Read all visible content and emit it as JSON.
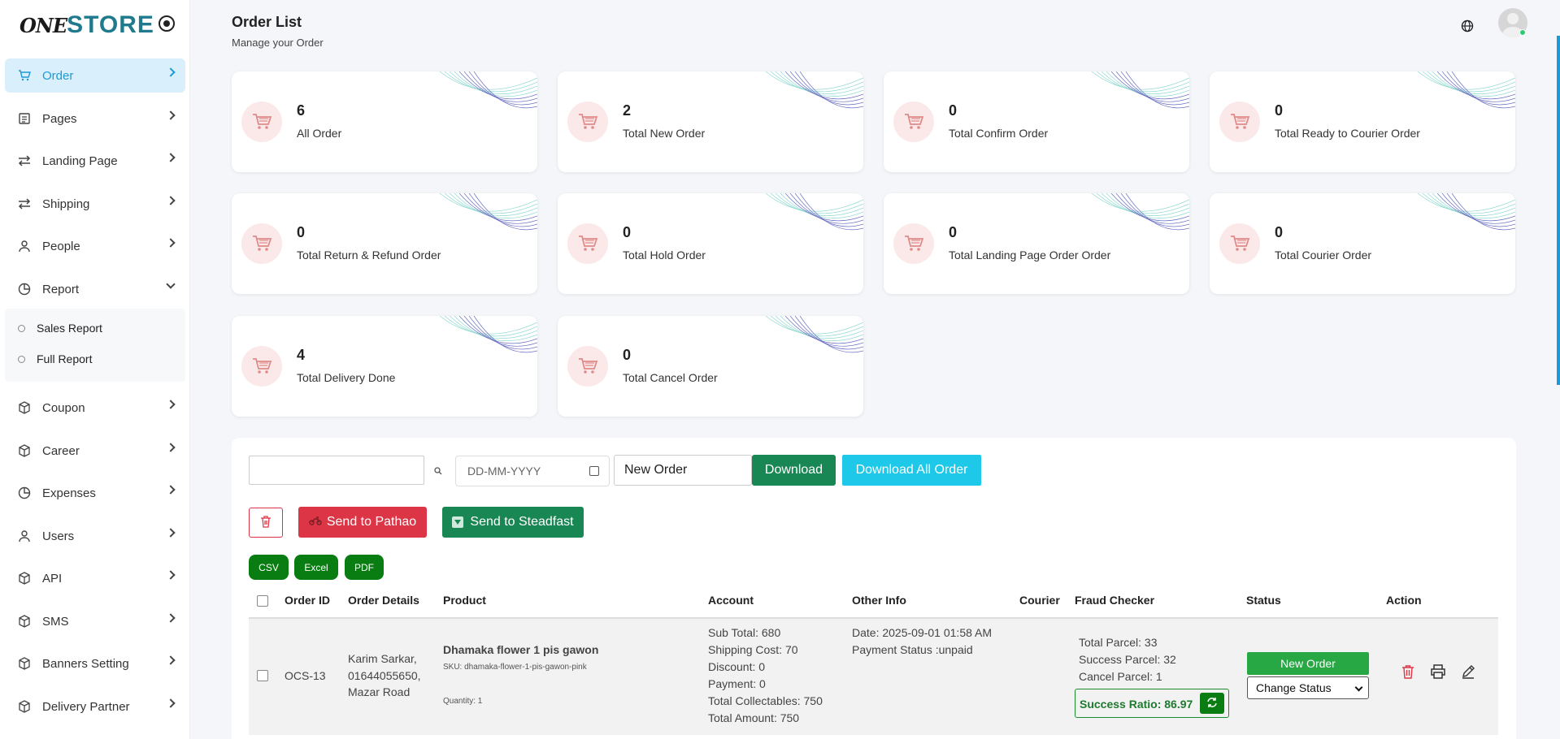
{
  "brand": {
    "logo_one": "ONE",
    "logo_store": "STORE"
  },
  "sidebar": {
    "items": [
      {
        "label": "Order",
        "icon": "cart-icon"
      },
      {
        "label": "Pages",
        "icon": "pages-icon"
      },
      {
        "label": "Landing Page",
        "icon": "swap-icon"
      },
      {
        "label": "Shipping",
        "icon": "swap-icon"
      },
      {
        "label": "People",
        "icon": "person-icon"
      },
      {
        "label": "Report",
        "icon": "pie-chart-icon"
      },
      {
        "label": "Coupon",
        "icon": "box-icon"
      },
      {
        "label": "Career",
        "icon": "box-icon"
      },
      {
        "label": "Expenses",
        "icon": "pie-chart-icon"
      },
      {
        "label": "Users",
        "icon": "person-icon"
      },
      {
        "label": "API",
        "icon": "box-icon"
      },
      {
        "label": "SMS",
        "icon": "box-icon"
      },
      {
        "label": "Banners Setting",
        "icon": "box-icon"
      },
      {
        "label": "Delivery Partner",
        "icon": "box-icon"
      }
    ],
    "report_sub": [
      "Sales Report",
      "Full Report"
    ]
  },
  "header": {
    "title": "Order List",
    "subtitle": "Manage your Order"
  },
  "stats": [
    {
      "value": "6",
      "label": "All Order"
    },
    {
      "value": "2",
      "label": "Total New Order"
    },
    {
      "value": "0",
      "label": "Total Confirm Order"
    },
    {
      "value": "0",
      "label": "Total Ready to Courier Order"
    },
    {
      "value": "0",
      "label": "Total Return & Refund Order"
    },
    {
      "value": "0",
      "label": "Total Hold Order"
    },
    {
      "value": "0",
      "label": "Total Landing Page Order Order"
    },
    {
      "value": "0",
      "label": "Total Courier Order"
    },
    {
      "value": "4",
      "label": "Total Delivery Done"
    },
    {
      "value": "0",
      "label": "Total Cancel Order"
    }
  ],
  "filters": {
    "search_value": "",
    "date_placeholder": "DD-MM-YYYY",
    "status_value": "New Order",
    "download_label": "Download",
    "download_all_label": "Download All Order"
  },
  "actions": {
    "pathao_label": "Send to Pathao",
    "steadfast_label": "Send to Steadfast"
  },
  "exports": [
    "CSV",
    "Excel",
    "PDF"
  ],
  "table": {
    "headers": [
      "Order ID",
      "Order Details",
      "Product",
      "Account",
      "Other Info",
      "Courier",
      "Fraud Checker",
      "Status",
      "Action"
    ],
    "row": {
      "order_id": "OCS-13",
      "details": [
        "Karim Sarkar,",
        "01644055650,",
        "Mazar Road"
      ],
      "product_name": "Dhamaka flower 1 pis gawon",
      "product_sku": "SKU: dhamaka-flower-1-pis-gawon-pink",
      "product_qty": "Quantity: 1",
      "account": [
        "Sub Total: 680",
        "Shipping Cost: 70",
        "Discount: 0",
        "Payment: 0",
        "Total Collectables: 750",
        "Total Amount: 750"
      ],
      "other_info": [
        "Date: 2025-09-01 01:58 AM",
        "Payment Status :unpaid"
      ],
      "fraud": [
        "Total Parcel: 33",
        "Success Parcel: 32",
        "Cancel Parcel: 1"
      ],
      "success_ratio": "Success Ratio: 86.97",
      "status_badge": "New Order",
      "change_status": "Change Status"
    }
  },
  "colors": {
    "accent": "#1a9bd8",
    "danger": "#dc3545",
    "success": "#198754",
    "info": "#1ec8e8"
  }
}
